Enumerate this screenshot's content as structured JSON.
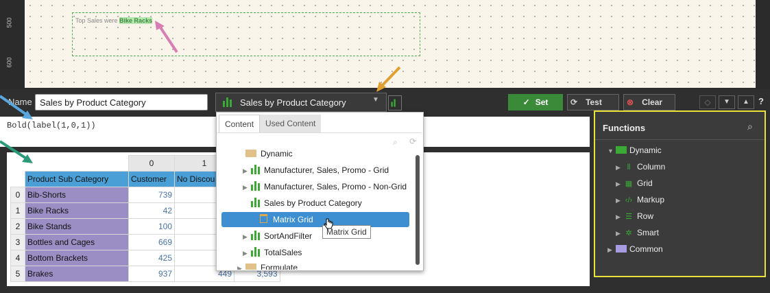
{
  "canvas": {
    "ruler_ticks": [
      "500",
      "600"
    ],
    "textbox_prefix": "Top Sales were ",
    "textbox_highlight": "Bike Racks"
  },
  "toolbar": {
    "name_label": "Name",
    "name_value": "Sales by Product Category",
    "datasource_value": "Sales by Product Category",
    "set_label": "Set",
    "test_label": "Test",
    "clear_label": "Clear",
    "help_label": "?"
  },
  "formula": "Bold(label(1,0,1))",
  "grid": {
    "col_numbers": [
      "0",
      "1"
    ],
    "header": [
      "Product Sub Category",
      "Customer",
      "No Discou"
    ],
    "rows": [
      {
        "idx": "0",
        "cat": "Bib-Shorts",
        "c0": "739",
        "c1": "",
        "c2": ""
      },
      {
        "idx": "1",
        "cat": "Bike Racks",
        "c0": "42",
        "c1": "",
        "c2": ""
      },
      {
        "idx": "2",
        "cat": "Bike Stands",
        "c0": "100",
        "c1": "",
        "c2": ""
      },
      {
        "idx": "3",
        "cat": "Bottles and Cages",
        "c0": "669",
        "c1": "",
        "c2": ""
      },
      {
        "idx": "4",
        "cat": "Bottom Brackets",
        "c0": "425",
        "c1": "",
        "c2": ""
      },
      {
        "idx": "5",
        "cat": "Brakes",
        "c0": "937",
        "c1": "449",
        "c2": "3,593"
      }
    ]
  },
  "dropdown": {
    "tabs": [
      "Content",
      "Used Content"
    ],
    "tree": [
      {
        "label": "Dynamic",
        "type": "folder",
        "level": 0
      },
      {
        "label": "Manufacturer, Sales, Promo - Grid",
        "type": "chart",
        "level": 1
      },
      {
        "label": "Manufacturer, Sales, Promo - Non-Grid",
        "type": "chart",
        "level": 1
      },
      {
        "label": "Sales by Product Category",
        "type": "chart",
        "level": 1
      },
      {
        "label": "Matrix Grid",
        "type": "grid",
        "level": 2
      },
      {
        "label": "SortAndFilter",
        "type": "chart",
        "level": 1
      },
      {
        "label": "TotalSales",
        "type": "chart",
        "level": 1
      },
      {
        "label": "Formulate",
        "type": "folder",
        "level": 0
      }
    ],
    "tooltip": "Matrix Grid"
  },
  "functions": {
    "title": "Functions",
    "items": [
      {
        "label": "Dynamic",
        "icon": "folder-icon",
        "level": 0
      },
      {
        "label": "Column",
        "icon": "column-icon",
        "level": 1
      },
      {
        "label": "Grid",
        "icon": "grid-icon",
        "level": 1
      },
      {
        "label": "Markup",
        "icon": "markup-icon",
        "level": 1
      },
      {
        "label": "Row",
        "icon": "row-icon",
        "level": 1
      },
      {
        "label": "Smart",
        "icon": "smart-icon",
        "level": 1
      },
      {
        "label": "Common",
        "icon": "folder-icon",
        "level": 0
      }
    ]
  },
  "colors": {
    "accent_green": "#3aa935",
    "highlight_yellow": "#e8e23a",
    "selection_blue": "#4a9fd6",
    "category_purple": "#9b8ec4"
  }
}
